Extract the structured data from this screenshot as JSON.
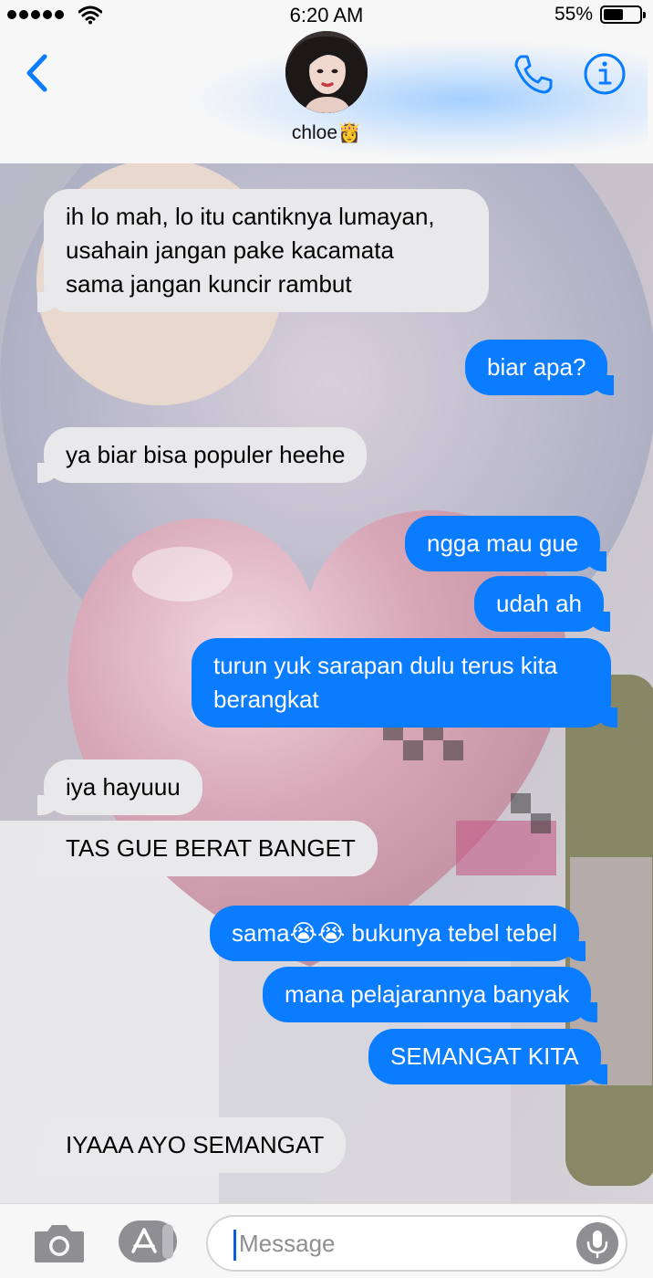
{
  "status_bar": {
    "time": "6:20 AM",
    "battery_percent": "55%",
    "battery_level": 0.55,
    "signal_bars": 5
  },
  "header": {
    "contact_name": "chloe👸",
    "icons": [
      "back-chevron-icon",
      "phone-icon",
      "info-icon"
    ]
  },
  "colors": {
    "accent": "#0a7cff",
    "incoming_bubble": "#e9e9eb",
    "outgoing_bubble": "#0a7cff"
  },
  "messages": [
    {
      "sender": "contact",
      "text": "ih lo mah, lo itu cantiknya lumayan,\nusahain jangan pake kacamata\nsama jangan kuncir rambut"
    },
    {
      "sender": "me",
      "text": "biar apa?"
    },
    {
      "sender": "contact",
      "text": "ya biar bisa populer heehe"
    },
    {
      "sender": "me",
      "text": "ngga mau gue"
    },
    {
      "sender": "me",
      "text": "udah ah"
    },
    {
      "sender": "me",
      "text": "turun yuk sarapan dulu terus kita\nberangkat"
    },
    {
      "sender": "contact",
      "text": "iya hayuuu"
    },
    {
      "sender": "contact",
      "text": "TAS GUE BERAT BANGET"
    },
    {
      "sender": "me",
      "text": "sama😭😭 bukunya tebel tebel"
    },
    {
      "sender": "me",
      "text": "mana pelajarannya banyak"
    },
    {
      "sender": "me",
      "text": "SEMANGAT KITA"
    },
    {
      "sender": "contact",
      "text": "IYAAA AYO SEMANGAT"
    }
  ],
  "input_bar": {
    "placeholder": "Message",
    "value": "",
    "icons": [
      "camera-icon",
      "app-store-icon",
      "microphone-icon"
    ]
  }
}
